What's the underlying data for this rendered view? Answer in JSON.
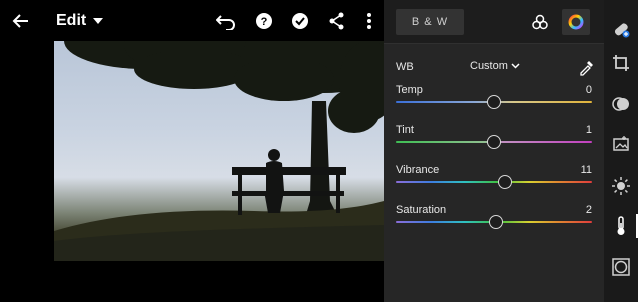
{
  "topbar": {
    "mode_label": "Edit",
    "icons": [
      "back-arrow-icon",
      "undo-icon",
      "help-icon",
      "done-check-icon",
      "share-icon",
      "more-icon"
    ]
  },
  "panel": {
    "bw_label": "B & W",
    "wb": {
      "label": "WB",
      "selected": "Custom"
    },
    "sliders": [
      {
        "label": "Temp",
        "value": "0",
        "level": 0.5,
        "gradient": "temp"
      },
      {
        "label": "Tint",
        "value": "1",
        "level": 0.5025,
        "gradient": "tint"
      },
      {
        "label": "Vibrance",
        "value": "11",
        "level": 0.555,
        "gradient": "color"
      },
      {
        "label": "Saturation",
        "value": "2",
        "level": 0.51,
        "gradient": "color"
      }
    ]
  },
  "tools": [
    "healing-brush-icon",
    "crop-icon",
    "masking-icon",
    "presets-icon",
    "light-icon",
    "color-thermometer-icon",
    "effects-vignette-icon"
  ],
  "colors": {
    "panel_bg": "#262626",
    "toolbar_bg": "#1a1a1a",
    "accent": "#ffffff"
  }
}
